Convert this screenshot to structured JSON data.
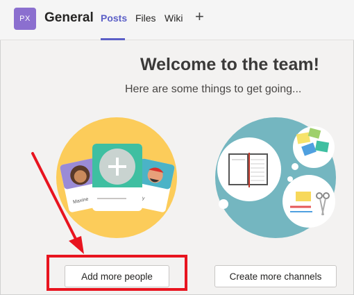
{
  "header": {
    "avatar_initials": "PX",
    "channel_name": "General",
    "tabs": [
      "Posts",
      "Files",
      "Wiki"
    ],
    "active_tab": "Posts",
    "add_tab_icon": "plus-icon"
  },
  "welcome": {
    "title": "Welcome to the team!",
    "subtitle": "Here are some things to get going..."
  },
  "illustrations": {
    "people_card_names": [
      "Maxine",
      "ky"
    ]
  },
  "actions": {
    "add_people_label": "Add more people",
    "create_channels_label": "Create more channels"
  },
  "colors": {
    "accent": "#5b5fc7",
    "annotation": "#e8141f",
    "people_circle": "#fccc5a",
    "channel_circle": "#74b6c0"
  }
}
